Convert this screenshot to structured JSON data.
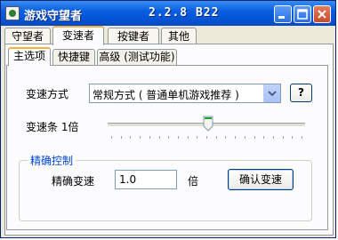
{
  "window": {
    "title": "游戏守望者",
    "version": "2.2.8 B22"
  },
  "tabs": [
    {
      "label": "守望者"
    },
    {
      "label": "变速者"
    },
    {
      "label": "按键者"
    },
    {
      "label": "其他"
    }
  ],
  "inner_tabs": [
    {
      "label": "主选项"
    },
    {
      "label": "快捷键"
    },
    {
      "label": "高级 (测试功能)"
    }
  ],
  "speed_mode": {
    "label": "变速方式",
    "selected": "常规方式 ( 普通单机游戏推荐 )",
    "help_label": "?"
  },
  "speed_bar": {
    "label": "变速条 1倍",
    "level": 0.5
  },
  "precise": {
    "group_title": "精确控制",
    "label": "精确变速",
    "value": "1.0",
    "unit": "倍",
    "confirm_label": "确认变速"
  }
}
